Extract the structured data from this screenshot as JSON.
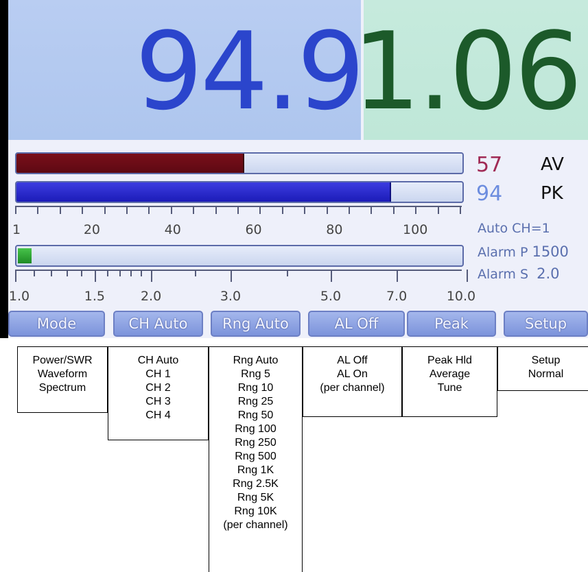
{
  "readout": {
    "power_value": "94.9",
    "swr_value": "1.06"
  },
  "bars": {
    "average": {
      "value": "57",
      "label": "AV",
      "fill_fraction": 0.51,
      "color": "#7a0f1a"
    },
    "peak": {
      "value": "94",
      "label": "PK",
      "fill_fraction": 0.84,
      "color": "#2a2ad0"
    },
    "alarm": {
      "fill_fraction": 0.03,
      "color": "#2fa033"
    }
  },
  "status": {
    "auto_ch": "Auto CH=1",
    "alarm_p_label": "Alarm P",
    "alarm_p_value": "1500",
    "alarm_s_label": "Alarm S",
    "alarm_s_value": "2.0"
  },
  "scale_top_labels": [
    "1",
    "20",
    "40",
    "60",
    "80",
    "100"
  ],
  "scale_bottom_labels": [
    "1.0",
    "1.5",
    "2.0",
    "3.0",
    "5.0",
    "7.0",
    "10.0"
  ],
  "buttons": [
    "Mode",
    "CH Auto",
    "Rng Auto",
    "AL Off",
    "Peak",
    "Setup"
  ],
  "menus": {
    "mode": [
      "Power/SWR",
      "Waveform",
      "Spectrum"
    ],
    "channel": [
      "CH Auto",
      "CH 1",
      "CH 2",
      "CH 3",
      "CH 4"
    ],
    "range": [
      "Rng Auto",
      "Rng 5",
      "Rng 10",
      "Rng 25",
      "Rng 50",
      "Rng 100",
      "Rng 250",
      "Rng 500",
      "Rng 1K",
      "Rng 2.5K",
      "Rng 5K",
      "Rng 10K",
      "(per channel)"
    ],
    "alarm": [
      "AL Off",
      "AL On",
      "(per channel)"
    ],
    "peak": [
      "Peak Hld",
      "Average",
      "Tune"
    ],
    "setup": [
      "Setup",
      "Normal"
    ]
  }
}
